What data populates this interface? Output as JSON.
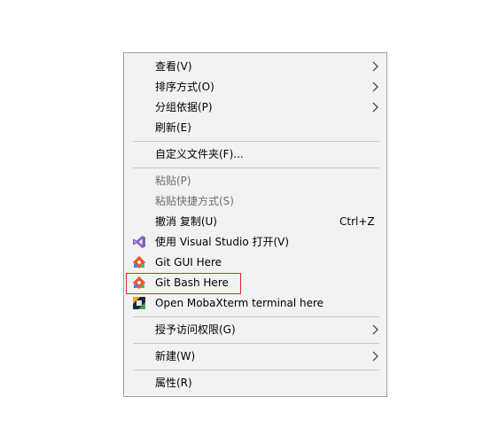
{
  "context_menu": {
    "items": [
      {
        "id": "view",
        "label": "查看(V)",
        "submenu": true,
        "enabled": true
      },
      {
        "id": "sort",
        "label": "排序方式(O)",
        "submenu": true,
        "enabled": true
      },
      {
        "id": "group",
        "label": "分组依据(P)",
        "submenu": true,
        "enabled": true
      },
      {
        "id": "refresh",
        "label": "刷新(E)",
        "submenu": false,
        "enabled": true
      },
      {
        "id": "customize",
        "label": "自定义文件夹(F)...",
        "submenu": false,
        "enabled": true
      },
      {
        "id": "paste",
        "label": "粘贴(P)",
        "submenu": false,
        "enabled": false
      },
      {
        "id": "paste-shortcut",
        "label": "粘贴快捷方式(S)",
        "submenu": false,
        "enabled": false
      },
      {
        "id": "undo-copy",
        "label": "撤消 复制(U)",
        "shortcut": "Ctrl+Z",
        "submenu": false,
        "enabled": true
      },
      {
        "id": "open-vs",
        "label": "使用 Visual Studio 打开(V)",
        "icon": "visual-studio-icon",
        "submenu": false,
        "enabled": true
      },
      {
        "id": "git-gui",
        "label": "Git GUI Here",
        "icon": "git-icon",
        "submenu": false,
        "enabled": true
      },
      {
        "id": "git-bash",
        "label": "Git Bash Here",
        "icon": "git-icon",
        "submenu": false,
        "enabled": true,
        "highlighted": true
      },
      {
        "id": "mobaxterm",
        "label": "Open MobaXterm terminal here",
        "icon": "mobaxterm-icon",
        "submenu": false,
        "enabled": true
      },
      {
        "id": "access",
        "label": "授予访问权限(G)",
        "submenu": true,
        "enabled": true
      },
      {
        "id": "new",
        "label": "新建(W)",
        "submenu": true,
        "enabled": true
      },
      {
        "id": "properties",
        "label": "属性(R)",
        "submenu": false,
        "enabled": true
      }
    ]
  },
  "colors": {
    "menu_background": "#f2f2f2",
    "menu_border": "#a0a0a0",
    "separator": "#c7c7c7",
    "disabled_text": "#6d6d6d",
    "highlight_box": "#e0282b",
    "git_orange": "#f05133",
    "visual_studio_purple": "#865fc5"
  }
}
